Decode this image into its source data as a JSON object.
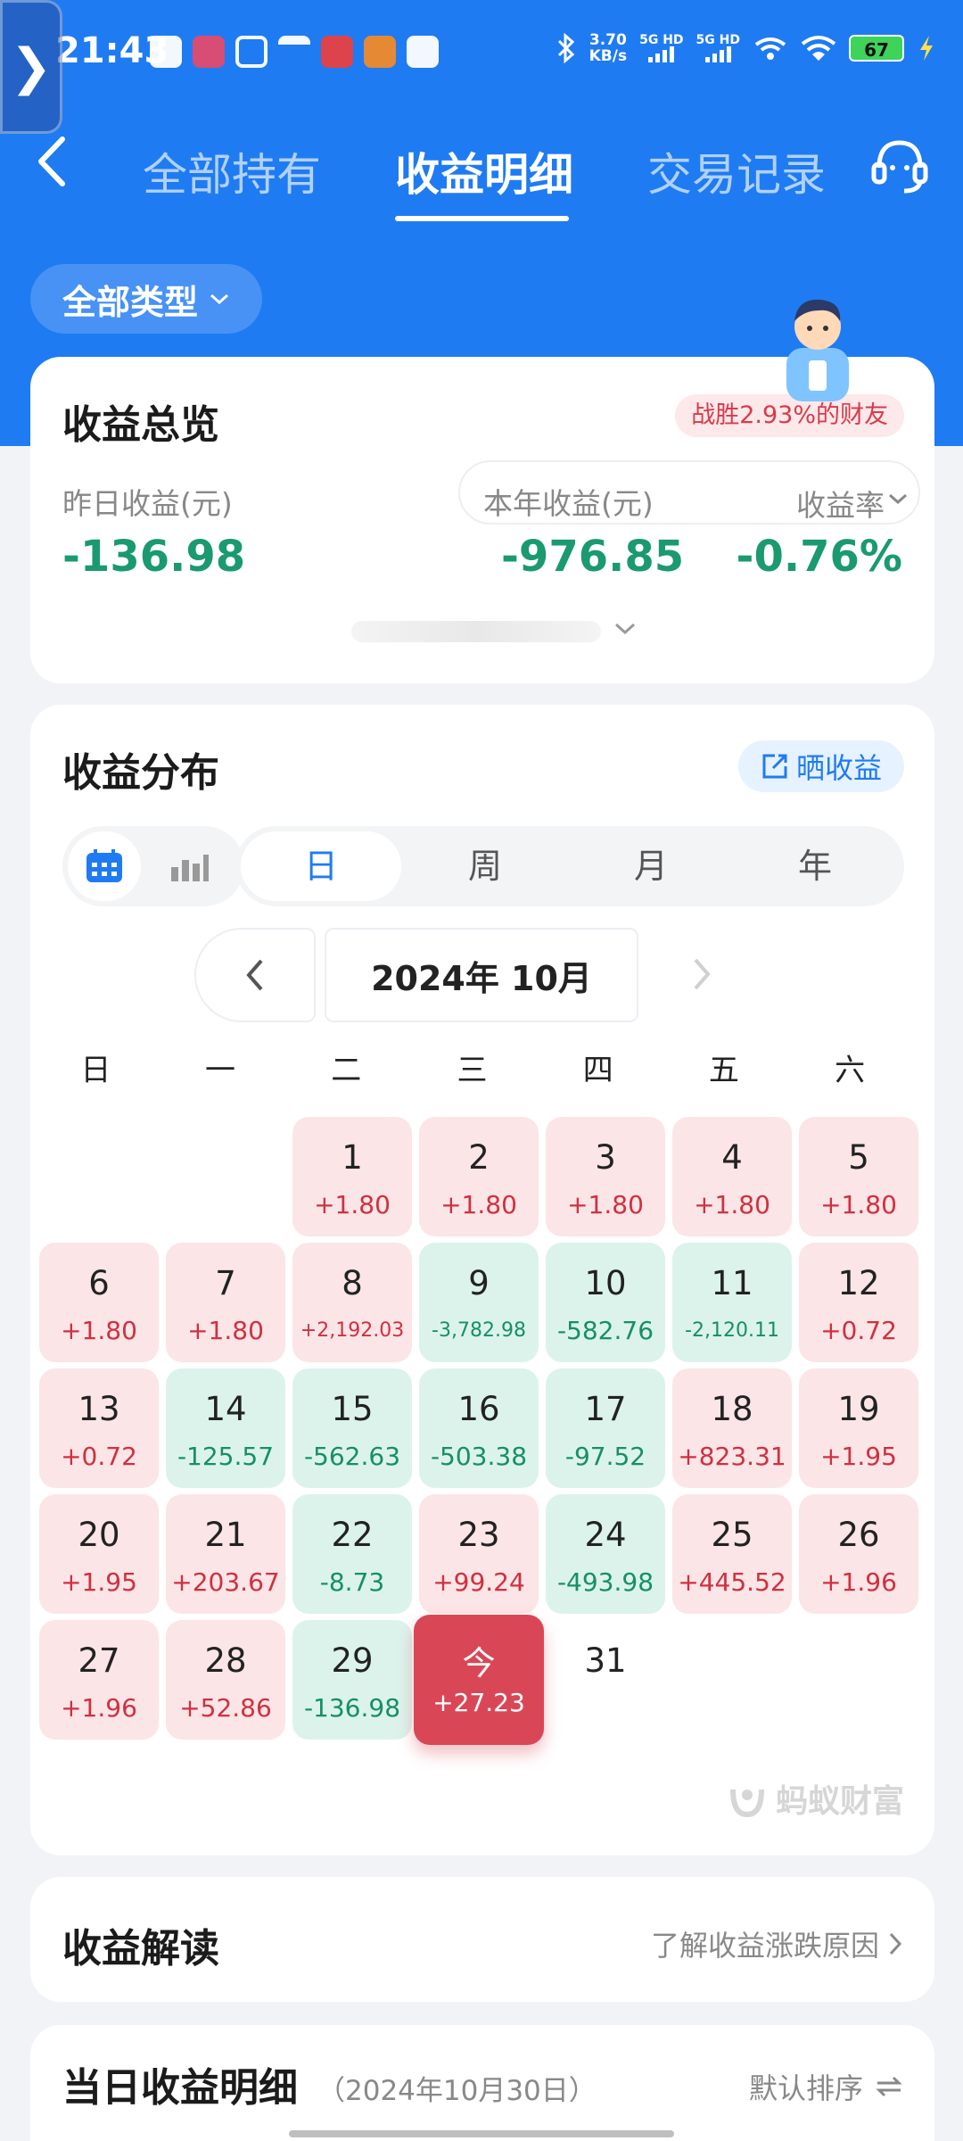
{
  "status_bar": {
    "time": "21:43",
    "net_speed_value": "3.70",
    "net_speed_unit": "KB/s",
    "signal1": "5G HD",
    "signal2": "5G HD",
    "battery": "67"
  },
  "nav": {
    "tabs": [
      {
        "label": "全部持有"
      },
      {
        "label": "收益明细"
      },
      {
        "label": "交易记录"
      }
    ],
    "active_tab": "收益明细",
    "accent": "#1f7bf2"
  },
  "filter": {
    "type_label": "全部类型"
  },
  "overview": {
    "title": "收益总览",
    "beat_badge": "战胜2.93%的财友",
    "yesterday_label": "昨日收益(元)",
    "yesterday_value": "-136.98",
    "year_label": "本年收益(元)",
    "year_value": "-976.85",
    "rate_label": "收益率",
    "rate_value": "-0.76%"
  },
  "distribution": {
    "title": "收益分布",
    "share_label": "晒收益",
    "period_tabs": [
      "日",
      "周",
      "月",
      "年"
    ],
    "active_period": "日",
    "month_label": "2024年 10月",
    "weekdays": [
      "日",
      "一",
      "二",
      "三",
      "四",
      "五",
      "六"
    ],
    "days": [
      {
        "d": "1",
        "v": "+1.80"
      },
      {
        "d": "2",
        "v": "+1.80"
      },
      {
        "d": "3",
        "v": "+1.80"
      },
      {
        "d": "4",
        "v": "+1.80"
      },
      {
        "d": "5",
        "v": "+1.80"
      },
      {
        "d": "6",
        "v": "+1.80"
      },
      {
        "d": "7",
        "v": "+1.80"
      },
      {
        "d": "8",
        "v": "+2,192.03"
      },
      {
        "d": "9",
        "v": "-3,782.98"
      },
      {
        "d": "10",
        "v": "-582.76"
      },
      {
        "d": "11",
        "v": "-2,120.11"
      },
      {
        "d": "12",
        "v": "+0.72"
      },
      {
        "d": "13",
        "v": "+0.72"
      },
      {
        "d": "14",
        "v": "-125.57"
      },
      {
        "d": "15",
        "v": "-562.63"
      },
      {
        "d": "16",
        "v": "-503.38"
      },
      {
        "d": "17",
        "v": "-97.52"
      },
      {
        "d": "18",
        "v": "+823.31"
      },
      {
        "d": "19",
        "v": "+1.95"
      },
      {
        "d": "20",
        "v": "+1.95"
      },
      {
        "d": "21",
        "v": "+203.67"
      },
      {
        "d": "22",
        "v": "-8.73"
      },
      {
        "d": "23",
        "v": "+99.24"
      },
      {
        "d": "24",
        "v": "-493.98"
      },
      {
        "d": "25",
        "v": "+445.52"
      },
      {
        "d": "26",
        "v": "+1.96"
      },
      {
        "d": "27",
        "v": "+1.96"
      },
      {
        "d": "28",
        "v": "+52.86"
      },
      {
        "d": "29",
        "v": "-136.98"
      },
      {
        "d": "今",
        "v": "+27.23",
        "today": true
      },
      {
        "d": "31",
        "v": ""
      }
    ],
    "first_weekday_index": 2,
    "watermark": "蚂蚁财富"
  },
  "interpretation": {
    "title": "收益解读",
    "link": "了解收益涨跌原因"
  },
  "daily_detail": {
    "title": "当日收益明细",
    "date": "（2024年10月30日）",
    "sort": "默认排序"
  },
  "colors": {
    "positive": "#d0303f",
    "negative": "#169064",
    "positive_bg": "#fbe5e7",
    "negative_bg": "#dcf3ec",
    "today_bg": "#d94756"
  }
}
